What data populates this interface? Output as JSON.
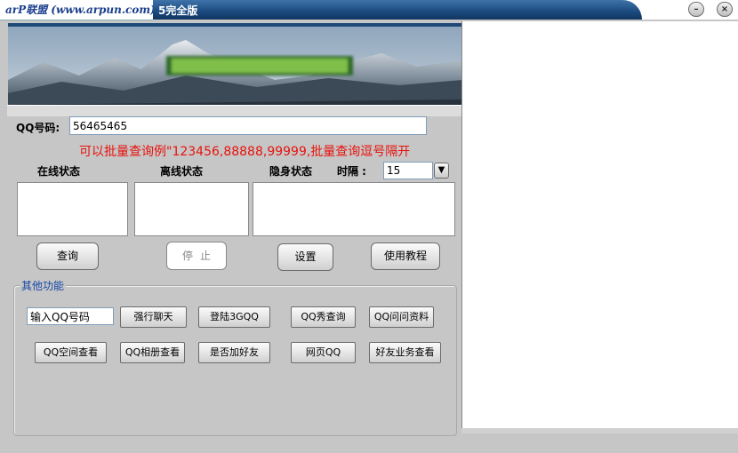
{
  "window": {
    "logo_text": "arP联盟 (www.arpun.com)",
    "title": "5完全版",
    "minimize_label": "–",
    "close_label": "×"
  },
  "qq": {
    "label": "QQ号码:",
    "value": "56465465",
    "hint": "可以批量查询例\"123456,88888,99999,批量查询逗号隔开"
  },
  "status": {
    "online_label": "在线状态",
    "offline_label": "离线状态",
    "hidden_label": "隐身状态",
    "interval_label": "时隔 :",
    "interval_value": "15"
  },
  "buttons": {
    "query": "查询",
    "stop": "停止",
    "settings": "设置",
    "tutorial": "使用教程"
  },
  "other": {
    "legend": "其他功能",
    "input_value": "输入QQ号码",
    "force_chat": "强行聊天",
    "login_3gqq": "登陆3GQQ",
    "qqshow_query": "QQ秀查询",
    "qq_ask_profile": "QQ问问资料",
    "qzone_view": "QQ空间查看",
    "album_view": "QQ相册查看",
    "is_friend": "是否加好友",
    "web_qq": "网页QQ",
    "friend_service": "好友业务查看"
  },
  "colors": {
    "titlebar_blue": "#1b4a7f",
    "hint_red": "#e8120c",
    "legend_blue": "#1747a8"
  }
}
